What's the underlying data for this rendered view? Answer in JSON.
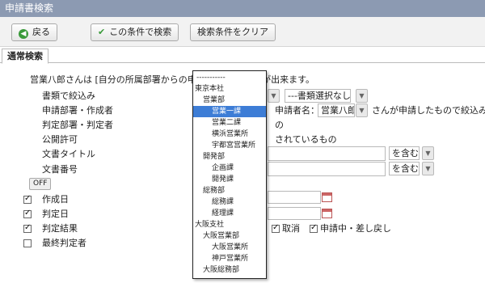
{
  "title": "申請書検索",
  "toolbar": {
    "back": "戻る",
    "search": "この条件で検索",
    "clear": "検索条件をクリア"
  },
  "tab": "通常検索",
  "description": "営業八郎さんは [自分の所属部署からの申請]を検索する事が出来ます。",
  "description_hidden_part": "[自分の所属部署からの申",
  "labels": {
    "doctype": "書類で絞込み",
    "applicant": "申請部署・作成者",
    "judge": "判定部署・判定者",
    "public": "公開許可",
    "doc_title": "文書タイトル",
    "doc_number": "文書番号",
    "off": "OFF",
    "created": "作成日",
    "judged": "判定日",
    "result": "判定結果",
    "final_judge": "最終判定者"
  },
  "doctype_select": "---書類選択なし---",
  "applicant_name_label": "申請者名：",
  "applicant_name_value": "営業八郎",
  "applicant_suffix": "さんが申請したもので絞込み",
  "partial_1": "の",
  "partial_2": "されているもの",
  "match_1": "を含む",
  "match_2": "を含む",
  "result_options": {
    "cancel": "取消",
    "pending": "申請中・差し戻し"
  },
  "dropdown": {
    "selected": "営業一課",
    "items": [
      "-----------",
      "東京本社",
      "営業部",
      "営業一課",
      "営業二課",
      "横浜営業所",
      "宇都宮営業所",
      "開発部",
      "企画課",
      "開発課",
      "総務部",
      "総務課",
      "経理課",
      "大阪支社",
      "大阪営業部",
      "大阪営業所",
      "神戸営業所",
      "大阪総務部"
    ]
  },
  "checkboxes": {
    "created": true,
    "judged": true,
    "result": true,
    "final_judge": false,
    "cancel": true,
    "pending": true
  },
  "colors": {
    "titlebar": "#8c9ab2",
    "highlight": "#3d7dd6",
    "icon_green": "#3a9a3a"
  }
}
